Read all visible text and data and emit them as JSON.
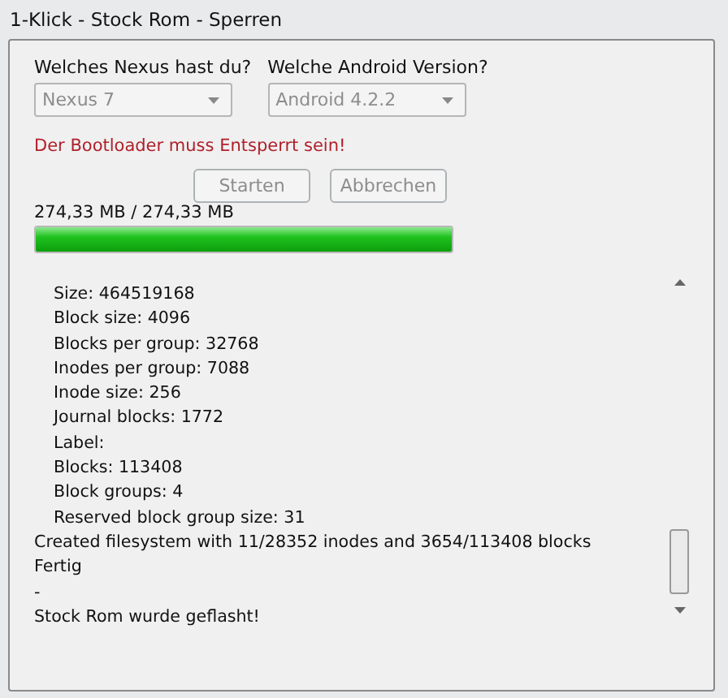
{
  "window": {
    "title": "1-Klick - Stock Rom - Sperren"
  },
  "device": {
    "label": "Welches Nexus hast du?",
    "value": "Nexus 7",
    "disabled": true
  },
  "version": {
    "label": "Welche Android Version?",
    "value": "Android 4.2.2",
    "disabled": true
  },
  "warning": "Der Bootloader muss Entsperrt sein!",
  "buttons": [
    {
      "label": "Starten",
      "disabled": true
    },
    {
      "label": "Abbrechen",
      "disabled": true
    }
  ],
  "progress": {
    "reading": "274,33 MB  /  274,33 MB",
    "level": 1
  },
  "log": [
    {
      "text": "Size: 464519168",
      "kind": "indented"
    },
    {
      "text": "Block size: 4096",
      "kind": "indented"
    },
    {
      "text": "Blocks per group: 32768",
      "kind": "indented"
    },
    {
      "text": "Inodes per group: 7088",
      "kind": "indented"
    },
    {
      "text": "Inode size: 256",
      "kind": "indented"
    },
    {
      "text": "Journal blocks: 1772",
      "kind": "indented"
    },
    {
      "text": "Label:",
      "kind": "indented"
    },
    {
      "text": "Blocks: 113408",
      "kind": "indented"
    },
    {
      "text": "Block groups: 4",
      "kind": "indented"
    },
    {
      "text": "Reserved block group size: 31",
      "kind": "indented"
    },
    {
      "text": "Created filesystem with 11/28352 inodes and 3654/113408 blocks",
      "kind": "plain"
    },
    {
      "text": "Fertig",
      "kind": "plain"
    },
    {
      "text": "-",
      "kind": "plain"
    },
    {
      "text": "Stock Rom wurde geflasht!",
      "kind": "plain"
    }
  ]
}
